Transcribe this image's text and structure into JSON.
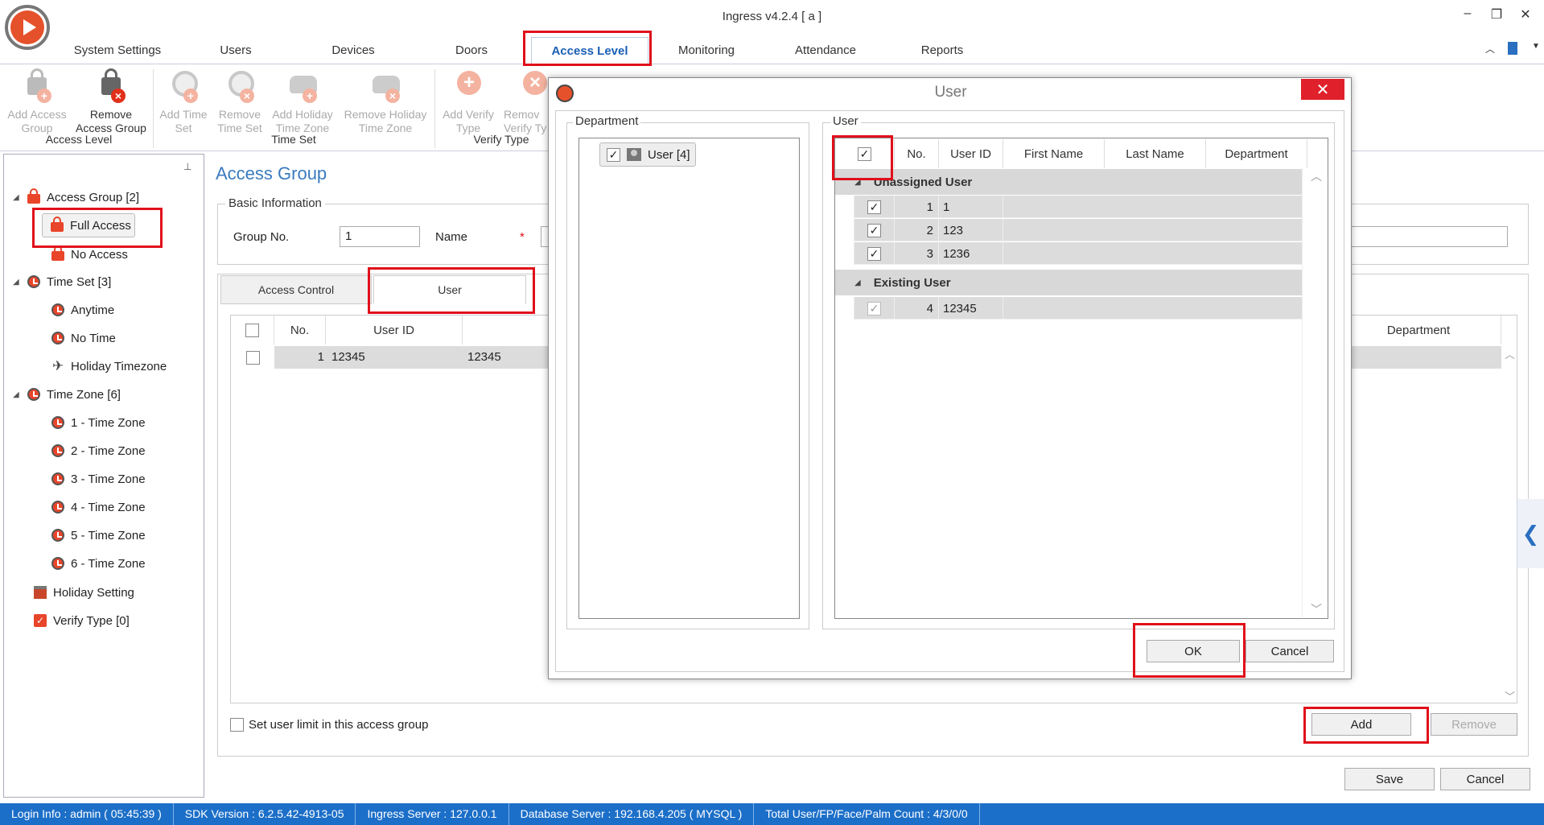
{
  "app": {
    "title": "Ingress v4.2.4 [ a ]",
    "win_min": "–",
    "win_max": "❐",
    "win_close": "✕"
  },
  "menu": {
    "tabs": [
      "System Settings",
      "Users",
      "Devices",
      "Doors",
      "Access Level",
      "Monitoring",
      "Attendance",
      "Reports"
    ],
    "active": "Access Level"
  },
  "ribbon": {
    "buttons": [
      {
        "label": "Add Access Group",
        "l1": "Add Access",
        "l2": "Group",
        "enabled": false
      },
      {
        "label": "Remove Access Group",
        "l1": "Remove",
        "l2": "Access Group",
        "enabled": true
      },
      {
        "label": "Add Time Set",
        "l1": "Add Time",
        "l2": "Set",
        "enabled": false
      },
      {
        "label": "Remove Time Set",
        "l1": "Remove",
        "l2": "Time Set",
        "enabled": false
      },
      {
        "label": "Add Holiday Time Zone",
        "l1": "Add Holiday",
        "l2": "Time Zone",
        "enabled": false
      },
      {
        "label": "Remove Holiday Time Zone",
        "l1": "Remove Holiday",
        "l2": "Time Zone",
        "enabled": false
      },
      {
        "label": "Add Verify Type",
        "l1": "Add Verify",
        "l2": "Type",
        "enabled": false
      },
      {
        "label": "Remove Verify Type",
        "l1": "Remov",
        "l2": "Verify Ty",
        "enabled": false
      }
    ],
    "groups": [
      "Access Level",
      "Time Set",
      "Verify Type"
    ]
  },
  "tree": {
    "access_group": "Access Group [2]",
    "full_access": "Full Access",
    "no_access": "No Access",
    "time_set": "Time Set [3]",
    "anytime": "Anytime",
    "no_time": "No Time",
    "holiday_timezone": "Holiday Timezone",
    "time_zone": "Time Zone [6]",
    "zones": [
      "1 - Time Zone",
      "2 - Time Zone",
      "3 - Time Zone",
      "4 - Time Zone",
      "5 - Time Zone",
      "6 - Time Zone"
    ],
    "holiday_setting": "Holiday Setting",
    "verify_type": "Verify Type [0]",
    "pin": "⊥"
  },
  "main": {
    "title": "Access Group",
    "basic_info": "Basic Information",
    "group_no_label": "Group No.",
    "group_no_value": "1",
    "name_label": "Name",
    "required": "*",
    "tabs": [
      "Access Control",
      "User"
    ],
    "grid_headers": {
      "no": "No.",
      "user_id": "User ID",
      "department": "Department"
    },
    "rows": [
      {
        "no": "1",
        "user_id": "12345",
        "name": "12345"
      }
    ],
    "user_limit_label": "Set user limit in this access group",
    "add": "Add",
    "remove": "Remove",
    "save": "Save",
    "cancel": "Cancel"
  },
  "dialog": {
    "title": "User",
    "close": "✕",
    "department_label": "Department",
    "user_label": "User",
    "dept_node": "User [4]",
    "headers": {
      "no": "No.",
      "user_id": "User ID",
      "first_name": "First Name",
      "last_name": "Last Name",
      "department": "Department"
    },
    "group_unassigned": "Unassigned User",
    "group_existing": "Existing User",
    "unassigned": [
      {
        "no": "1",
        "user_id": "1",
        "checked": true
      },
      {
        "no": "2",
        "user_id": "123",
        "checked": true
      },
      {
        "no": "3",
        "user_id": "1236",
        "checked": true
      }
    ],
    "existing": [
      {
        "no": "4",
        "user_id": "12345",
        "checked": true
      }
    ],
    "ok": "OK",
    "cancel": "Cancel"
  },
  "status": {
    "login": "Login Info : admin ( 05:45:39 )",
    "sdk": "SDK Version : 6.2.5.42-4913-05",
    "ingress": "Ingress Server : 127.0.0.1",
    "db": "Database Server : 192.168.4.205 ( MYSQL )",
    "counts": "Total User/FP/Face/Palm Count : 4/3/0/0"
  },
  "colors": {
    "accent": "#1a5fb4",
    "highlight": "#e0101a",
    "status_bar": "#1c6fc8",
    "icon_red": "#e8452a"
  }
}
